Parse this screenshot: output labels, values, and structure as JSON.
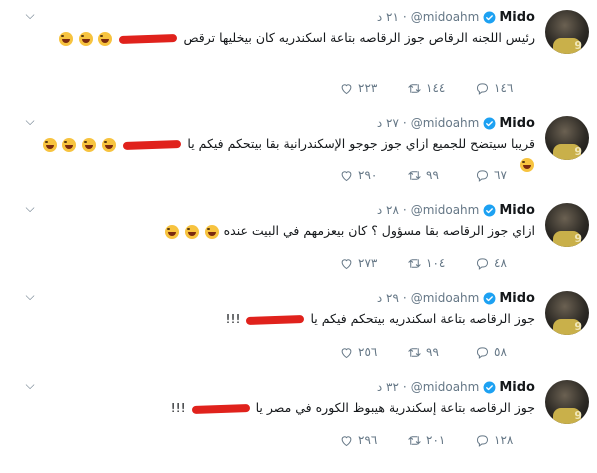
{
  "tweets": [
    {
      "name": "Mido",
      "handle": "@midoahm",
      "time": "٢١ د",
      "text_before": "رئيس اللجنه الرقاص جوز الرقاصه بتاعة اسكندريه كان بيخليها ترقص",
      "text_after": "",
      "emoji_count": 3,
      "reply": "١٤٦",
      "retweet": "١٤٤",
      "like": "٢٢٣"
    },
    {
      "name": "Mido",
      "handle": "@midoahm",
      "time": "٢٧ د",
      "text_before": "قريبا سيتضح للجميع ازاي جوز جوجو الإسكندرانية بقا بيتحكم فيكم يا",
      "text_after": "",
      "emoji_count": 5,
      "reply": "٦٧",
      "retweet": "٩٩",
      "like": "٢٩٠"
    },
    {
      "name": "Mido",
      "handle": "@midoahm",
      "time": "٢٨ د",
      "text_before": "ازاي جوز الرقاصه بقا مسؤول ؟ كان بيعزمهم في البيت عنده",
      "text_after": "",
      "emoji_count": 3,
      "reply": "٤٨",
      "retweet": "١٠٤",
      "like": "٢٧٣"
    },
    {
      "name": "Mido",
      "handle": "@midoahm",
      "time": "٢٩ د",
      "text_before": "جوز الرقاصه بتاعة اسكندريه بيتحكم فيكم يا",
      "text_after": "!!!",
      "emoji_count": 0,
      "reply": "٥٨",
      "retweet": "٩٩",
      "like": "٢٥٦"
    },
    {
      "name": "Mido",
      "handle": "@midoahm",
      "time": "٣٢ د",
      "text_before": "جوز الرقاصه بتاعة إسكندرية هيبوظ الكوره في مصر يا",
      "text_after": "!!!",
      "emoji_count": 0,
      "reply": "١٢٨",
      "retweet": "٢٠١",
      "like": "٢٩٦"
    }
  ],
  "icons": {
    "chevron": "chevron-down-icon",
    "verified": "verified-badge-icon",
    "reply": "reply-icon",
    "retweet": "retweet-icon",
    "like": "heart-icon",
    "emoji": "face-with-tears-of-joy-icon"
  },
  "colors": {
    "verified": "#1da1f2",
    "redaction": "#e0221c",
    "secondary_text": "#657786"
  }
}
